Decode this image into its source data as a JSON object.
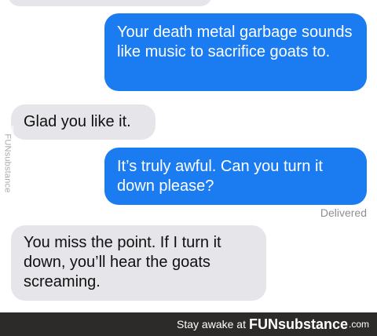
{
  "messages": [
    {
      "from": "me",
      "text": "Your death metal garbage sounds like music to sacrifice goats to."
    },
    {
      "from": "them",
      "text": "Glad you like it."
    },
    {
      "from": "me",
      "text": "It’s truly awful. Can you turn it down please?"
    },
    {
      "from": "them",
      "text": "You miss the point. If I turn it down, you’ll hear the goats screaming."
    }
  ],
  "status": {
    "delivered_label": "Delivered"
  },
  "watermark": {
    "text": "FUNsubstance"
  },
  "footer": {
    "prefix": "Stay awake at",
    "brand": "FUNsubstance",
    "domain": ".com"
  },
  "colors": {
    "sent_bubble": "#1b7cf2",
    "received_bubble": "#e5e5ea",
    "footer_bg": "#2d2a2a"
  }
}
